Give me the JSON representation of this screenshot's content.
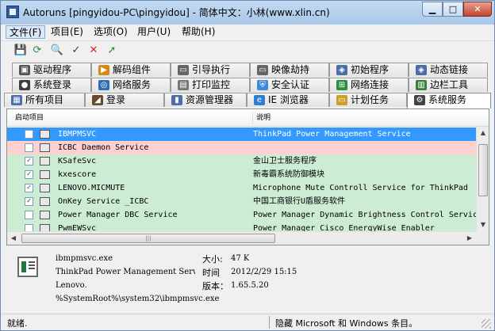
{
  "window": {
    "title": "Autoruns [pingyidou-PC\\pingyidou] - 简体中文：小林(www.xlin.cn)",
    "min_label": "▁",
    "max_label": "□",
    "close_label": "✕"
  },
  "menu": {
    "items": [
      "文件(F)",
      "项目(E)",
      "选项(O)",
      "用户(U)",
      "帮助(H)"
    ]
  },
  "toolbar": {
    "icons": [
      "save-icon",
      "refresh-icon",
      "find-icon",
      "verify-icon",
      "delete-icon",
      "jump-icon"
    ],
    "glyphs": [
      "💾",
      "⟳",
      "🔍",
      "✓",
      "✕",
      "➚"
    ]
  },
  "tabs": {
    "row1": [
      "驱动程序",
      "解码组件",
      "引导执行",
      "映像劫持",
      "初始程序",
      "动态链接"
    ],
    "row2": [
      "系统登录",
      "网络服务",
      "打印监控",
      "安全认证",
      "网络连接",
      "边栏工具"
    ],
    "row3": [
      "所有项目",
      "登录",
      "资源管理器",
      "IE 浏览器",
      "计划任务",
      "系统服务"
    ]
  },
  "list": {
    "col_entry": "启动项目",
    "col_desc": "说明",
    "rows": [
      {
        "name": "IBMPMSVC",
        "desc": "ThinkPad Power Management Service",
        "check": "",
        "state": "selected"
      },
      {
        "name": "ICBC Daemon Service",
        "desc": "",
        "check": "",
        "state": "pink"
      },
      {
        "name": "KSafeSvc",
        "desc": "金山卫士服务程序",
        "check": "✓",
        "state": "normal"
      },
      {
        "name": "kxescore",
        "desc": "新毒霸系统防御模块",
        "check": "✓",
        "state": "normal"
      },
      {
        "name": "LENOVO.MICMUTE",
        "desc": "Microphone Mute Controll Service for ThinkPad",
        "check": "✓",
        "state": "normal"
      },
      {
        "name": "OnKey Service _ICBC",
        "desc": "中国工商银行U盾服务软件",
        "check": "✓",
        "state": "normal"
      },
      {
        "name": "Power Manager DBC Service",
        "desc": "Power Manager Dynamic Brightness Control Service",
        "check": "",
        "state": "normal"
      },
      {
        "name": "PwmEWSvc",
        "desc": "Power Manager Cisco EnergyWise Enabler",
        "check": "",
        "state": "normal"
      }
    ]
  },
  "details": {
    "file": "ibmpmsvc.exe",
    "description": "ThinkPad Power Management Service",
    "company": "Lenovo.",
    "path": "%SystemRoot%\\system32\\ibmpmsvc.exe",
    "size_label": "大小:",
    "size_value": "47 K",
    "time_label": "时间",
    "time_value": "2012/2/29 15:15",
    "version_label": "版本：",
    "version_value": "1.65.5.20"
  },
  "status": {
    "left": "就绪.",
    "right": "隐藏 Microsoft 和 Windows 条目。"
  },
  "colors": {
    "selected_row": "#3399ff",
    "normal_row": "#ccecd4",
    "warning_row": "#ffd0d0",
    "titlebar": "#a9c7e8"
  }
}
